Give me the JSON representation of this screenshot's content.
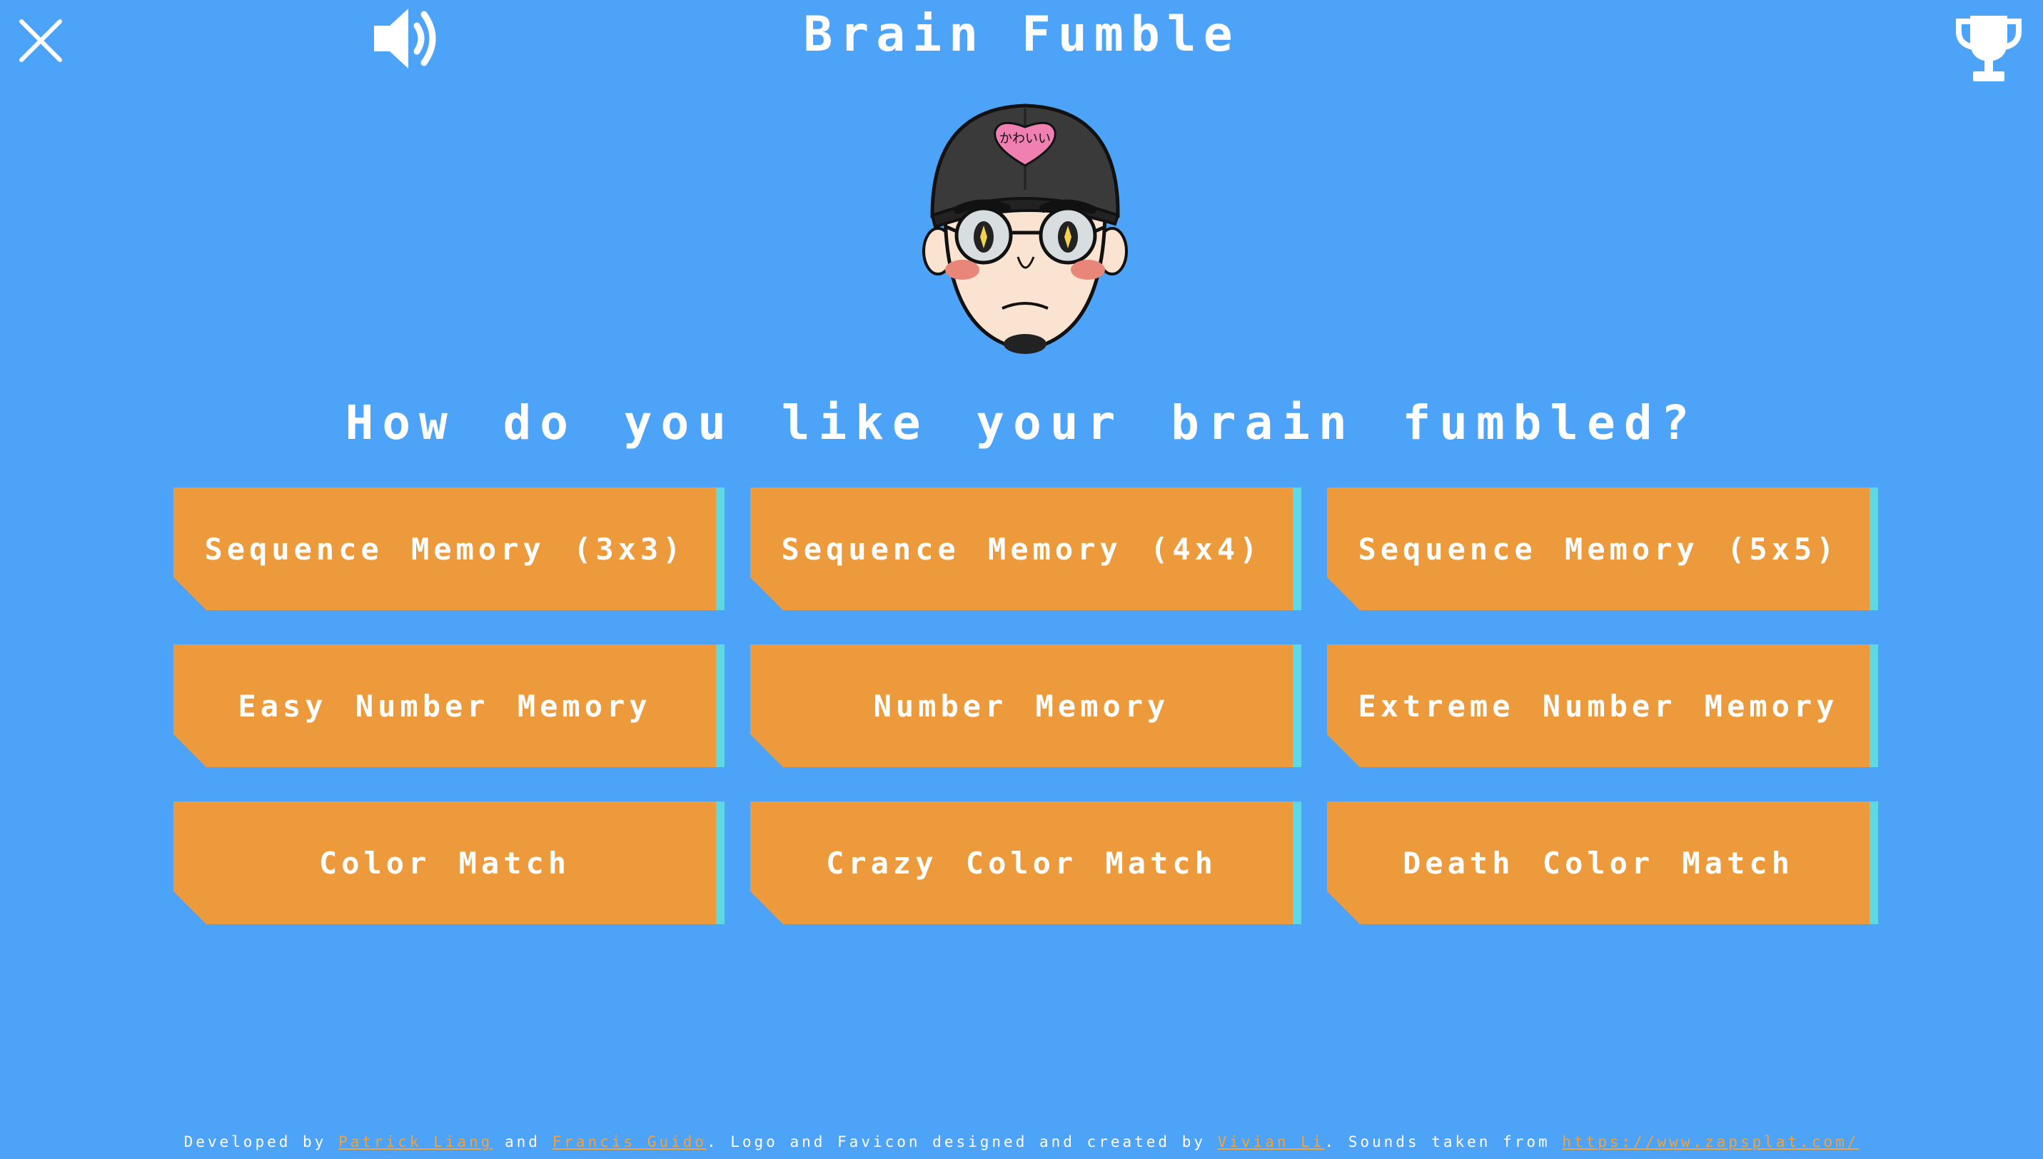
{
  "header": {
    "title": "Brain Fumble",
    "close_icon": "close-icon",
    "sound_icon": "volume-icon",
    "trophy_icon": "trophy-icon"
  },
  "logo": {
    "heart_text": "かわいい"
  },
  "prompt": "How do you like your brain fumbled?",
  "modes": [
    {
      "label": "Sequence Memory (3x3)"
    },
    {
      "label": "Sequence Memory (4x4)"
    },
    {
      "label": "Sequence Memory (5x5)"
    },
    {
      "label": "Easy Number Memory"
    },
    {
      "label": "Number Memory"
    },
    {
      "label": "Extreme Number Memory"
    },
    {
      "label": "Color Match"
    },
    {
      "label": "Crazy Color Match"
    },
    {
      "label": "Death Color Match"
    }
  ],
  "footer": {
    "developed_by": "Developed by",
    "dev1": "Patrick Liang",
    "and": "and",
    "dev2": "Francis Guido",
    "logo_credit": ". Logo and Favicon designed and created by",
    "designer": "Vivian Li",
    "sounds": ". Sounds taken from",
    "sound_url": "https://www.zapsplat.com/"
  },
  "colors": {
    "background": "#4da3f7",
    "button": "#ec9a3c",
    "button_accent": "#5fd8e6",
    "link": "#f0a33c"
  }
}
